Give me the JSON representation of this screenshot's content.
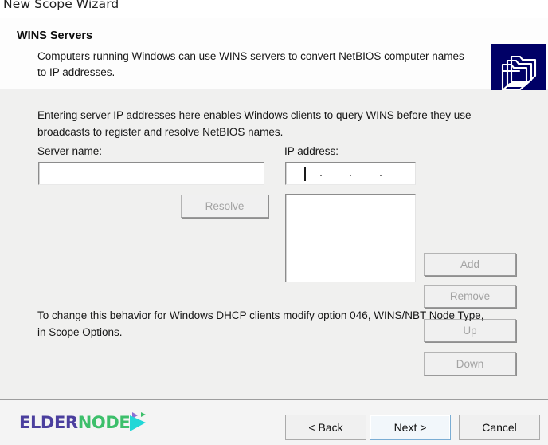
{
  "window": {
    "title": "New Scope Wizard"
  },
  "header": {
    "title": "WINS Servers",
    "description": "Computers running Windows can use WINS servers to convert NetBIOS computer names to IP addresses.",
    "icon": "folders-icon",
    "icon_bg": "#000066"
  },
  "body": {
    "intro": "Entering server IP addresses here enables Windows clients to query WINS before they use broadcasts to register and resolve NetBIOS names.",
    "server_name_label": "Server name:",
    "server_name_value": "",
    "server_name_placeholder": "",
    "ip_address_label": "IP address:",
    "ip_address_value": "",
    "ip_separators": [
      ".",
      ".",
      "."
    ],
    "ip_list_items": [],
    "outro": "To change this behavior for Windows DHCP clients modify option 046, WINS/NBT Node Type, in Scope Options.",
    "buttons": {
      "resolve": "Resolve",
      "add": "Add",
      "remove": "Remove",
      "up": "Up",
      "down": "Down"
    }
  },
  "footer": {
    "logo": {
      "part1": "ELDER",
      "part2": "NODE",
      "color1": "#4b3f9e",
      "color2": "#3dbf6b",
      "mark_color": "#20d7d7"
    },
    "back_label": "< Back",
    "next_label": "Next >",
    "cancel_label": "Cancel"
  }
}
